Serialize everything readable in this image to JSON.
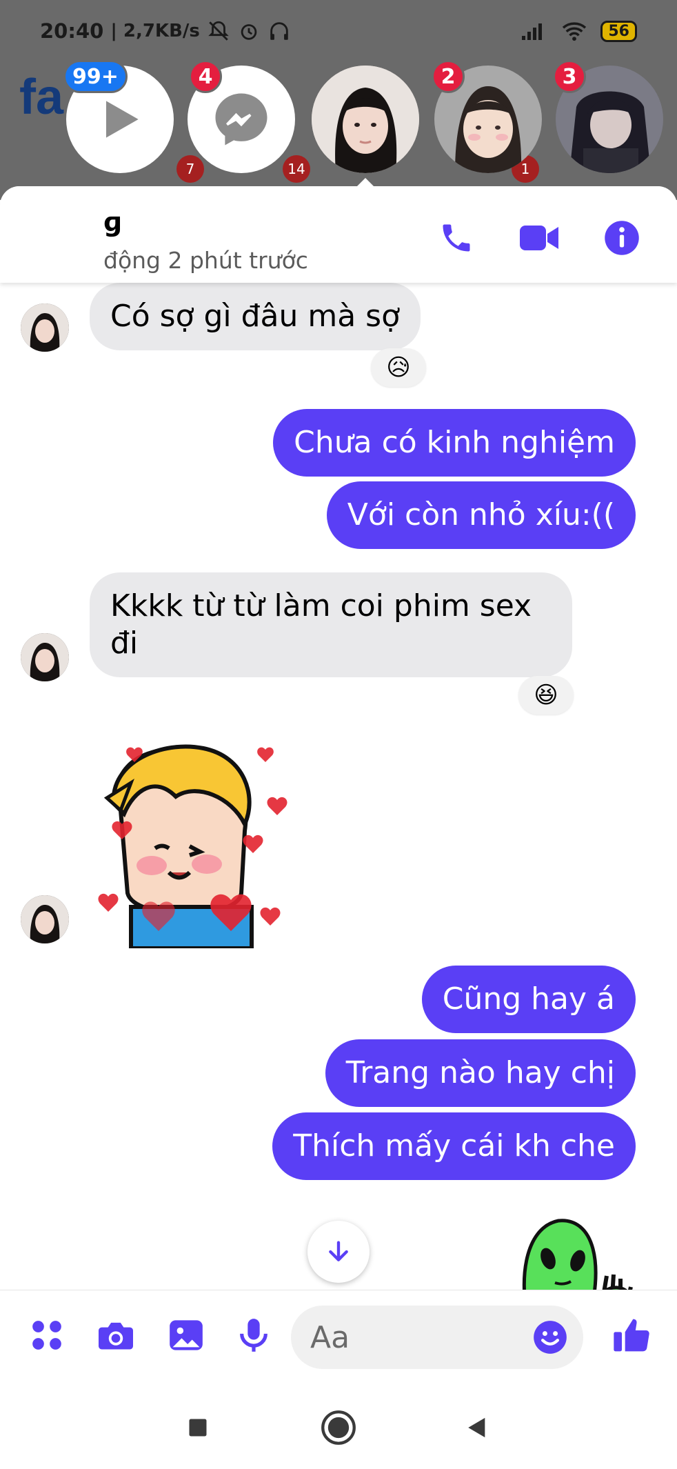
{
  "status_bar": {
    "time": "20:40",
    "speed": "| 2,7KB/s",
    "battery": "56"
  },
  "chat_heads": [
    {
      "badge": "99+",
      "icon": "play-icon"
    },
    {
      "badge": "4",
      "icon": "messenger-icon"
    },
    {
      "badge": "",
      "icon": "avatar"
    },
    {
      "badge": "2",
      "icon": "avatar"
    },
    {
      "badge": "3",
      "icon": "avatar"
    }
  ],
  "background_badges": [
    "7",
    "14",
    "1"
  ],
  "header": {
    "contact_name": "ɡ",
    "active_status": "động 2 phút trước",
    "icons": [
      "phone-icon",
      "video-icon",
      "info-icon"
    ]
  },
  "messages": [
    {
      "side": "in",
      "text": "Có sợ gì đâu mà sợ",
      "reaction": "😥"
    },
    {
      "side": "out",
      "text": "Chưa có kinh nghiệm"
    },
    {
      "side": "out",
      "text": "Với còn nhỏ xíu:(("
    },
    {
      "side": "in",
      "text": "Kkkk từ từ làm coi phim sex\nđi",
      "reaction": "😆"
    },
    {
      "side": "in",
      "sticker": "boy-hearts-sticker"
    },
    {
      "side": "out",
      "text": "Cũng hay á"
    },
    {
      "side": "out",
      "text": "Trang nào hay chị"
    },
    {
      "side": "out",
      "text": "Thích mấy cái kh che"
    },
    {
      "side": "out",
      "sticker": "green-alien-sticker"
    }
  ],
  "composer": {
    "placeholder": "Aa",
    "icons": [
      "apps-icon",
      "camera-icon",
      "gallery-icon",
      "mic-icon",
      "emoji-icon",
      "like-icon"
    ]
  },
  "colors": {
    "accent": "#5a3ff5",
    "incoming_bubble": "#e9e9eb",
    "badge_red": "#e41e3f",
    "badge_blue": "#1877f2"
  }
}
